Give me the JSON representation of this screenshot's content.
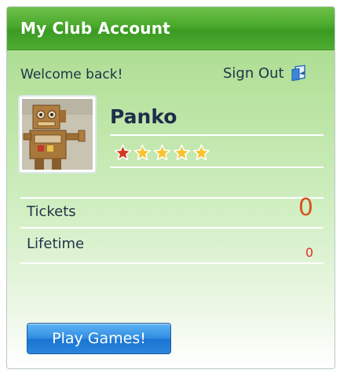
{
  "header": {
    "title": "My Club Account"
  },
  "welcome_text": "Welcome back!",
  "sign_out": {
    "label": "Sign Out",
    "icon": "sign-out-icon"
  },
  "user": {
    "name": "Panko",
    "avatar_icon": "robot-avatar",
    "rating": {
      "filled": 5,
      "max": 5,
      "first_star_color": "#d23a1f",
      "other_star_color": "#f7c531"
    }
  },
  "stats": [
    {
      "label": "Tickets",
      "value": "0",
      "color": "#d9531e"
    },
    {
      "label": "Lifetime",
      "value": "0",
      "color": "#e0302a"
    }
  ],
  "play_button": {
    "label": "Play Games!"
  },
  "colors": {
    "header_green": "#4aa82d",
    "panel_green": "#b8e3a0",
    "button_blue": "#2a86dc",
    "text_dark": "#1f3347"
  }
}
